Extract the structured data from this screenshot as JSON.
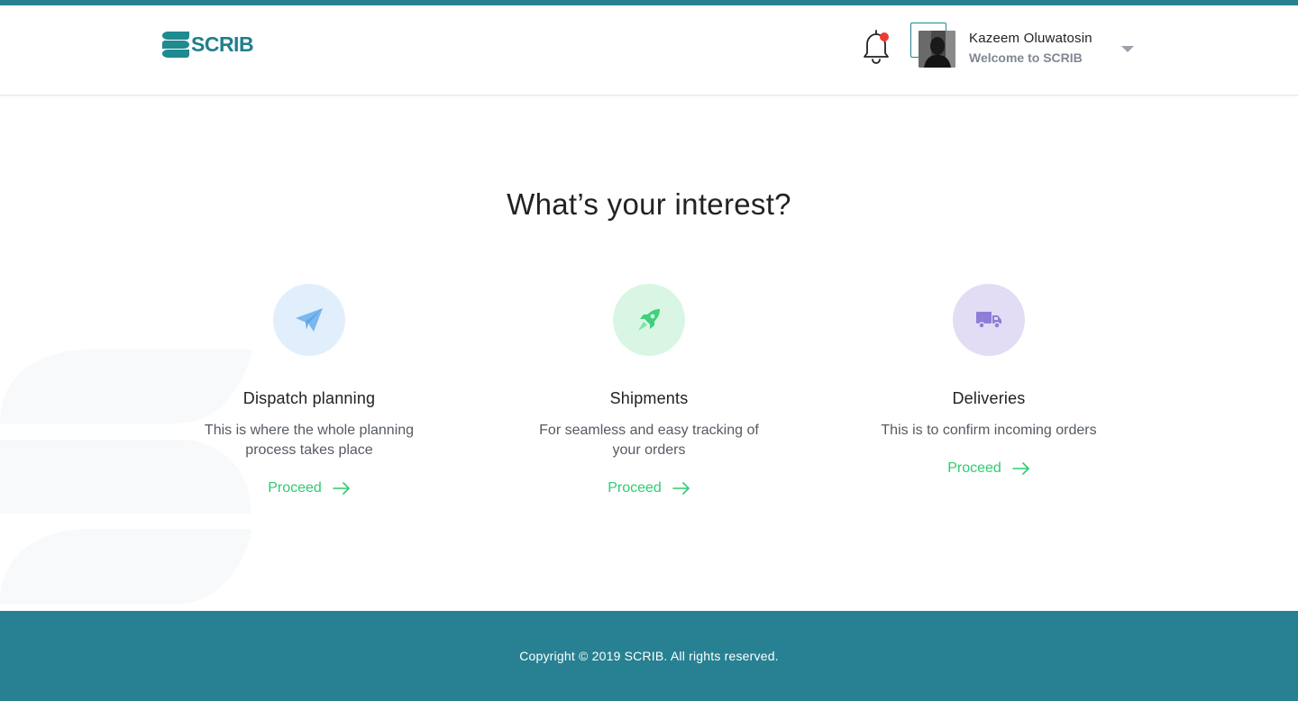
{
  "brand": {
    "name": "SCRIB",
    "logo_icon": "scrib-logo-icon",
    "primary_color": "#278192",
    "accent_color": "#2ecc71"
  },
  "header": {
    "notification_icon": "bell-icon",
    "notification_dot_color": "#ef3b2f",
    "user": {
      "name": "Kazeem Oluwatosin",
      "subtitle": "Welcome to SCRIB",
      "avatar": "avatar-photo",
      "menu_icon": "caret-down-icon"
    }
  },
  "main": {
    "title": "What’s your interest?",
    "cards": [
      {
        "icon": "paper-plane-icon",
        "icon_bg": "#e1effd",
        "icon_color": "#7ab8ef",
        "title": "Dispatch planning",
        "description": "This is where the whole planning process takes place",
        "link_label": "Proceed",
        "link_icon": "arrow-right-icon"
      },
      {
        "icon": "rocket-icon",
        "icon_bg": "#d9f6e4",
        "icon_color": "#3fd07b",
        "title": "Shipments",
        "description": "For seamless and easy tracking of your orders",
        "link_label": "Proceed",
        "link_icon": "arrow-right-icon"
      },
      {
        "icon": "truck-icon",
        "icon_bg": "#e3dcf5",
        "icon_color": "#8f7ed6",
        "title": "Deliveries",
        "description": "This is to confirm incoming orders",
        "link_label": "Proceed",
        "link_icon": "arrow-right-icon"
      }
    ]
  },
  "footer": {
    "copyright": "Copyright © 2019 SCRIB. All rights reserved."
  }
}
